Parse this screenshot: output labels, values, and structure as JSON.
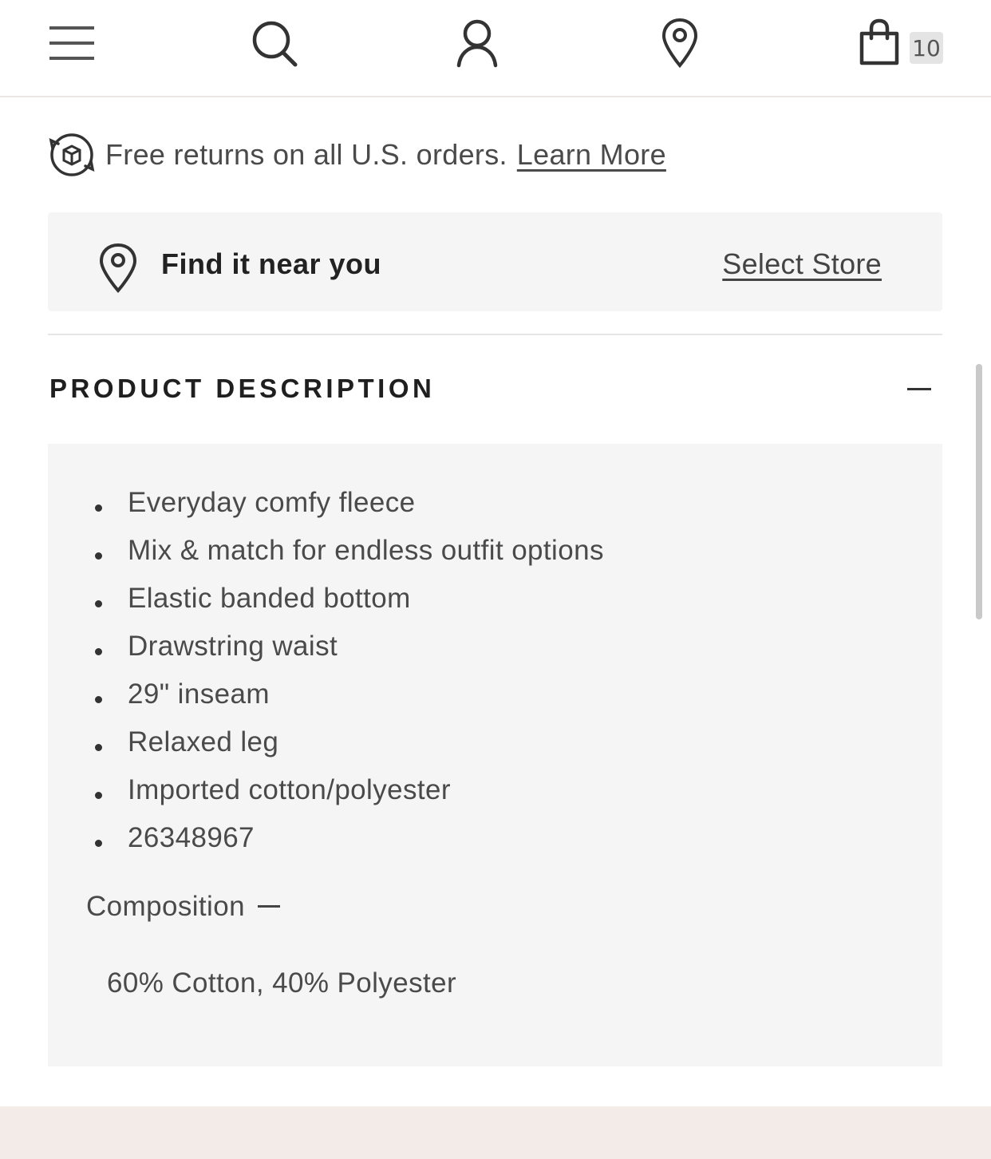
{
  "nav": {
    "icons": [
      "menu-icon",
      "search-icon",
      "account-icon",
      "store-locator-icon",
      "shopping-bag-icon"
    ],
    "cart_count": "10"
  },
  "returns": {
    "text": "Free returns on all U.S. orders.",
    "link": "Learn More"
  },
  "store": {
    "label": "Find it near you",
    "action": "Select Store"
  },
  "product_description": {
    "title": "PRODUCT DESCRIPTION",
    "bullets": [
      "Everyday comfy fleece",
      "Mix & match for endless outfit options",
      "Elastic banded bottom",
      "Drawstring waist",
      "29\" inseam",
      "Relaxed leg",
      "Imported cotton/polyester",
      "26348967"
    ],
    "composition_label": "Composition",
    "composition_value": "60% Cotton, 40% Polyester"
  },
  "colors": {
    "panel_bg": "#f5f5f5",
    "footer_bg": "#f3ebe8",
    "text": "#4a4a4a"
  }
}
